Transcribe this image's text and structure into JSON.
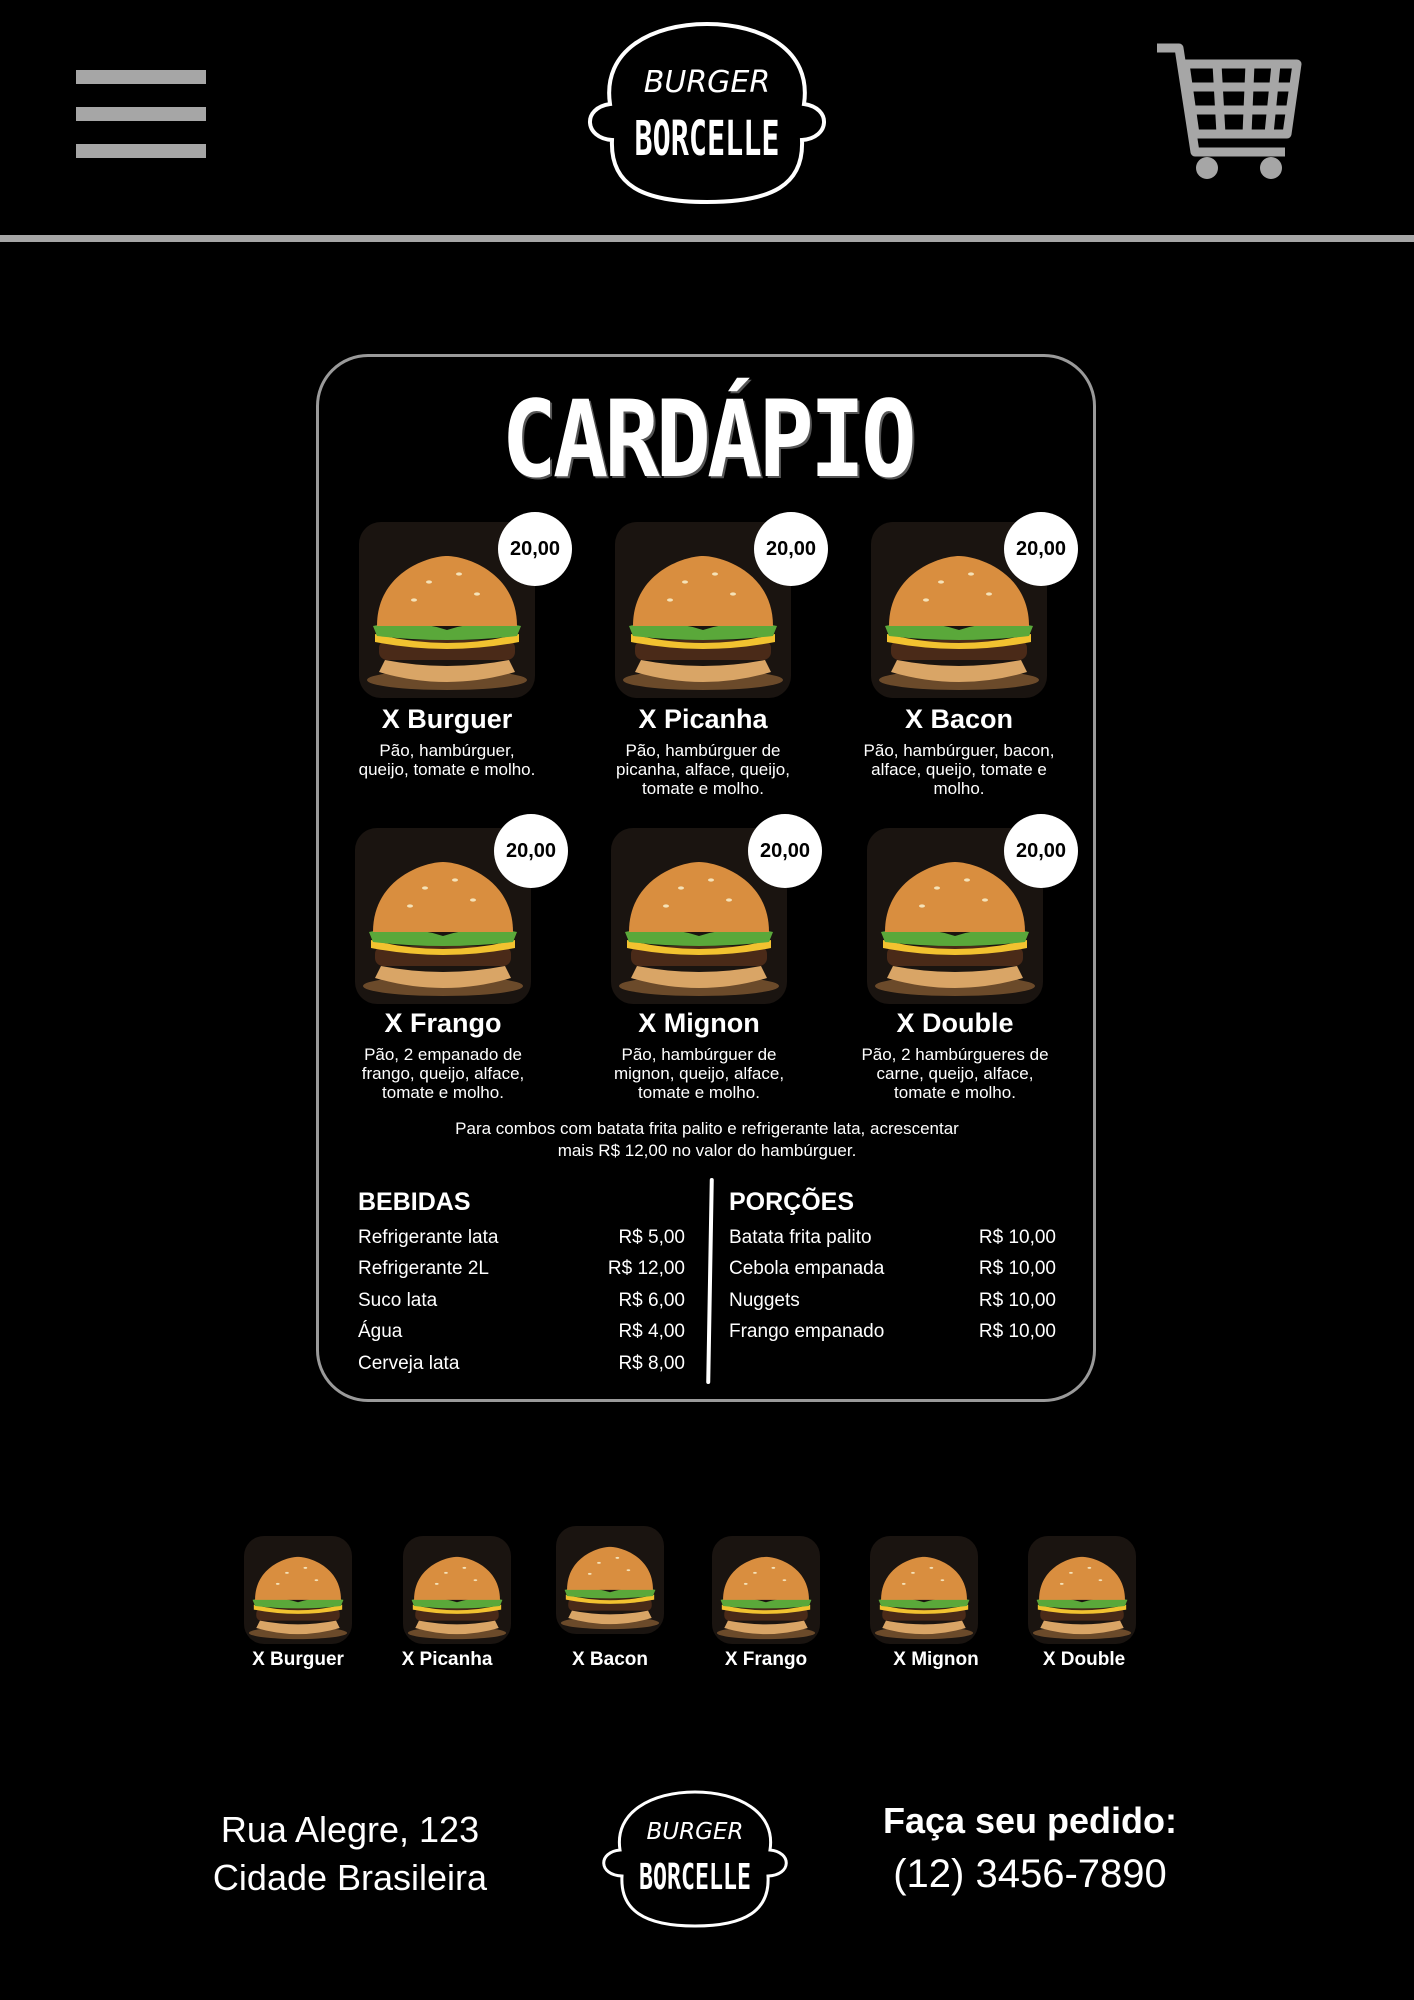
{
  "header": {
    "logo_top": "BURGER",
    "logo_main": "BORCELLE"
  },
  "menu": {
    "title": "CARDÁPIO",
    "items": [
      {
        "name": "X Burguer",
        "price": "20,00",
        "desc": [
          "Pão, hambúrguer,",
          "queijo, tomate e molho."
        ]
      },
      {
        "name": "X Picanha",
        "price": "20,00",
        "desc": [
          "Pão, hambúrguer de",
          "picanha, alface, queijo,",
          "tomate e molho."
        ]
      },
      {
        "name": "X Bacon",
        "price": "20,00",
        "desc": [
          "Pão, hambúrguer, bacon,",
          "alface, queijo, tomate e",
          "molho."
        ]
      },
      {
        "name": "X Frango",
        "price": "20,00",
        "desc": [
          "Pão, 2 empanado de",
          "frango, queijo, alface,",
          "tomate e molho."
        ]
      },
      {
        "name": "X Mignon",
        "price": "20,00",
        "desc": [
          "Pão, hambúrguer de",
          "mignon, queijo, alface,",
          "tomate e molho."
        ]
      },
      {
        "name": "X Double",
        "price": "20,00",
        "desc": [
          "Pão, 2 hambúrgueres de",
          "carne, queijo, alface,",
          "tomate e molho."
        ]
      }
    ],
    "combo_note": [
      "Para combos com batata frita palito e refrigerante lata, acrescentar",
      "mais R$ 12,00 no valor do hambúrguer."
    ],
    "bebidas": {
      "title": "BEBIDAS",
      "rows": [
        {
          "label": "Refrigerante lata",
          "price": "R$ 5,00"
        },
        {
          "label": "Refrigerante 2L",
          "price": "R$ 12,00"
        },
        {
          "label": "Suco lata",
          "price": "R$ 6,00"
        },
        {
          "label": "Água",
          "price": "R$ 4,00"
        },
        {
          "label": "Cerveja lata",
          "price": "R$ 8,00"
        }
      ]
    },
    "porcoes": {
      "title": "PORÇÕES",
      "rows": [
        {
          "label": "Batata frita palito",
          "price": "R$ 10,00"
        },
        {
          "label": "Cebola empanada",
          "price": "R$ 10,00"
        },
        {
          "label": "Nuggets",
          "price": "R$ 10,00"
        },
        {
          "label": "Frango empanado",
          "price": "R$ 10,00"
        }
      ]
    }
  },
  "gallery": {
    "items": [
      "X Burguer",
      "X Picanha",
      "X Bacon",
      "X Frango",
      "X Mignon",
      "X Double"
    ]
  },
  "footer": {
    "address": [
      "Rua Alegre, 123",
      "Cidade Brasileira"
    ],
    "logo_top": "BURGER",
    "logo_main": "BORCELLE",
    "order_title": "Faça seu pedido:",
    "phone": "(12) 3456-7890"
  },
  "colors": {
    "background": "#000000",
    "accent_gray": "#a6a6a6",
    "text": "#ffffff"
  }
}
